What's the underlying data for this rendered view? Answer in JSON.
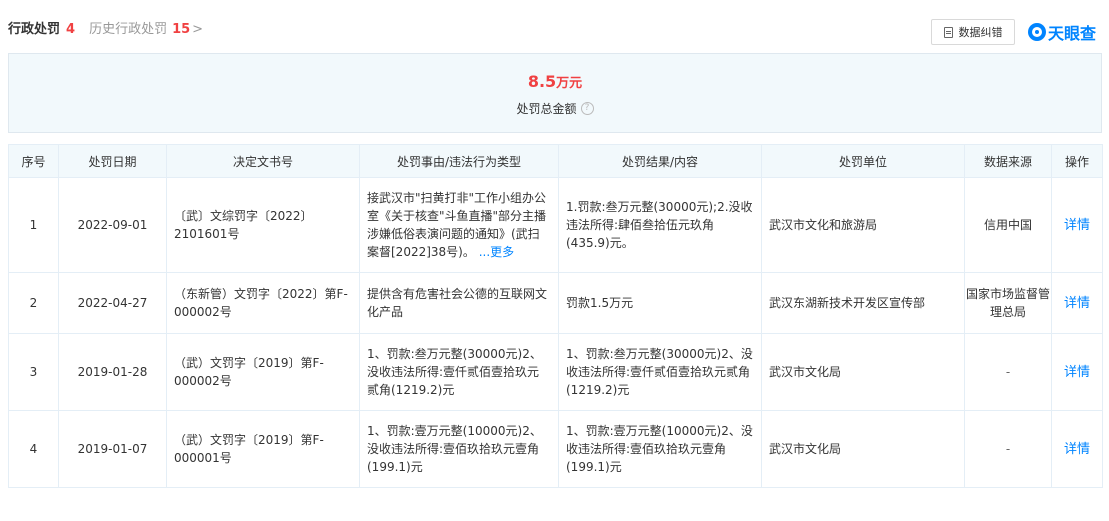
{
  "tabs": {
    "active": {
      "label": "行政处罚",
      "count": "4"
    },
    "history": {
      "label": "历史行政处罚",
      "count": "15",
      "chevron": ">"
    }
  },
  "toolbar": {
    "correct_label": "数据纠错",
    "logo_text": "天眼查"
  },
  "summary": {
    "amount": "8.5",
    "unit": "万元",
    "label": "处罚总金额",
    "help": "?"
  },
  "table": {
    "headers": [
      "序号",
      "处罚日期",
      "决定文书号",
      "处罚事由/违法行为类型",
      "处罚结果/内容",
      "处罚单位",
      "数据来源",
      "操作"
    ],
    "rows": [
      {
        "index": "1",
        "date": "2022-09-01",
        "doc_no": "〔武〕文综罚字〔2022〕2101601号",
        "reason": "接武汉市\"扫黄打非\"工作小组办公室《关于核查\"斗鱼直播\"部分主播涉嫌低俗表演问题的通知》(武扫案督[2022]38号)。",
        "reason_more": "...更多",
        "result": "1.罚款:叁万元整(30000元);2.没收违法所得:肆佰叁拾伍元玖角(435.9)元。",
        "unit": "武汉市文化和旅游局",
        "source": "信用中国",
        "action": "详情"
      },
      {
        "index": "2",
        "date": "2022-04-27",
        "doc_no": "（东新管）文罚字〔2022〕第F-000002号",
        "reason": "提供含有危害社会公德的互联网文化产品",
        "result": "罚款1.5万元",
        "unit": "武汉东湖新技术开发区宣传部",
        "source": "国家市场监督管理总局",
        "action": "详情"
      },
      {
        "index": "3",
        "date": "2019-01-28",
        "doc_no": "（武）文罚字〔2019〕第F-000002号",
        "reason": "1、罚款:叁万元整(30000元)2、没收违法所得:壹仟贰佰壹拾玖元贰角(1219.2)元",
        "result": "1、罚款:叁万元整(30000元)2、没收违法所得:壹仟贰佰壹拾玖元贰角(1219.2)元",
        "unit": "武汉市文化局",
        "source": "-",
        "action": "详情"
      },
      {
        "index": "4",
        "date": "2019-01-07",
        "doc_no": "（武）文罚字〔2019〕第F-000001号",
        "reason": "1、罚款:壹万元整(10000元)2、没收违法所得:壹佰玖拾玖元壹角(199.1)元",
        "result": "1、罚款:壹万元整(10000元)2、没收违法所得:壹佰玖拾玖元壹角(199.1)元",
        "unit": "武汉市文化局",
        "source": "-",
        "action": "详情"
      }
    ]
  },
  "colors": {
    "accent": "#0084ff",
    "count_red": "#f04142",
    "header_bg": "#f2f9fc",
    "border": "#e4eef6"
  }
}
